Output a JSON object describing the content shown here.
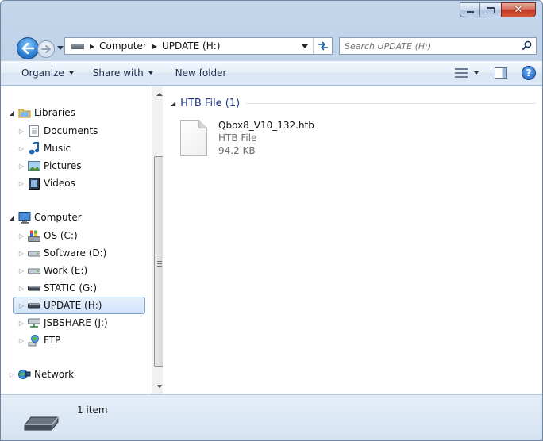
{
  "window": {
    "minimize_glyph": "",
    "close_glyph": "✕"
  },
  "address": {
    "crumbs": [
      "Computer",
      "UPDATE (H:)"
    ]
  },
  "search": {
    "placeholder": "Search UPDATE (H:)"
  },
  "toolbar": {
    "organize": "Organize",
    "share_with": "Share with",
    "new_folder": "New folder"
  },
  "nav": {
    "libraries": "Libraries",
    "documents": "Documents",
    "music": "Music",
    "pictures": "Pictures",
    "videos": "Videos",
    "computer": "Computer",
    "os": "OS (C:)",
    "software": "Software (D:)",
    "work": "Work (E:)",
    "static": "STATIC (G:)",
    "update": "UPDATE (H:)",
    "jsbshare": "JSBSHARE (J:)",
    "ftp": "FTP",
    "network": "Network"
  },
  "group": {
    "title": "HTB File (1)"
  },
  "file": {
    "name": "Qbox8_V10_132.htb",
    "type": "HTB File",
    "size": "94.2 KB"
  },
  "status": {
    "item_count": "1 item"
  },
  "colors": {
    "accent": "#1e3287",
    "selection": "#cfe3fb",
    "chrome": "#c4d6ea"
  }
}
